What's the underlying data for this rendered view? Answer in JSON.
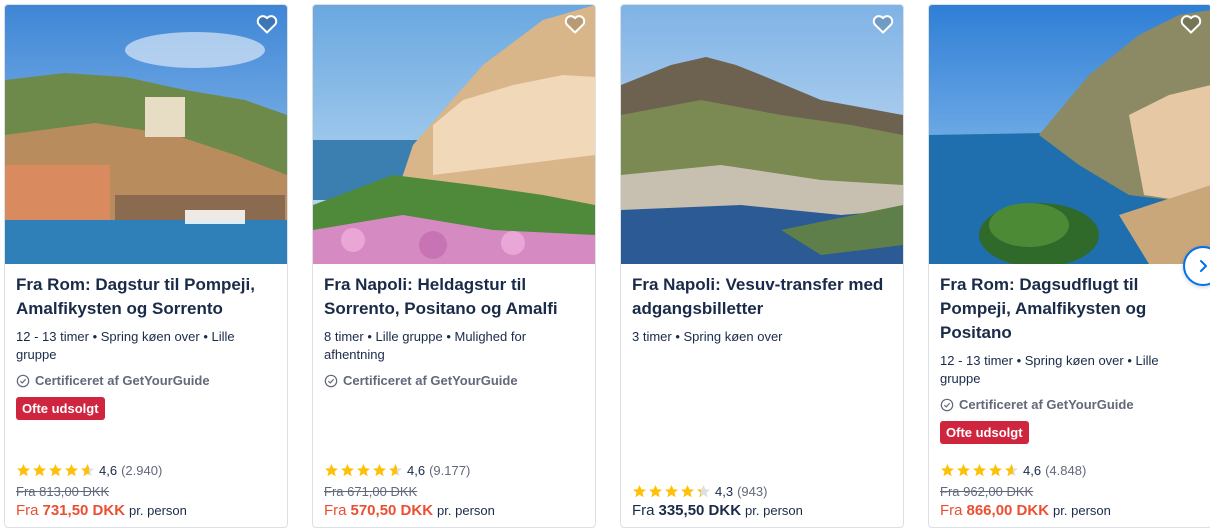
{
  "cards": [
    {
      "title": "Fra Rom: Dagstur til Pompeji, Amalfikysten og Sorrento",
      "meta": "12 - 13 timer • Spring køen over • Lille gruppe",
      "certified": "Certificeret af GetYourGuide",
      "badge": "Ofte udsolgt",
      "rating": "4,6",
      "rating_value": 4.6,
      "reviews": "(2.940)",
      "old_price": "Fra 813,00 DKK",
      "price_from": "Fra",
      "price": "731,50 DKK",
      "per": "pr. person",
      "on_sale": true
    },
    {
      "title": "Fra Napoli: Heldagstur til Sorrento, Positano og Amalfi",
      "meta": "8 timer • Lille gruppe • Mulighed for afhentning",
      "certified": "Certificeret af GetYourGuide",
      "badge": "",
      "rating": "4,6",
      "rating_value": 4.6,
      "reviews": "(9.177)",
      "old_price": "Fra 671,00 DKK",
      "price_from": "Fra",
      "price": "570,50 DKK",
      "per": "pr. person",
      "on_sale": true
    },
    {
      "title": "Fra Napoli: Vesuv-transfer med adgangsbilletter",
      "meta": "3 timer • Spring køen over",
      "certified": "",
      "badge": "",
      "rating": "4,3",
      "rating_value": 4.3,
      "reviews": "(943)",
      "old_price": "",
      "price_from": "Fra",
      "price": "335,50 DKK",
      "per": "pr. person",
      "on_sale": false
    },
    {
      "title": "Fra Rom: Dagsudflugt til Pompeji, Amalfikysten og Positano",
      "meta": "12 - 13 timer • Spring køen over • Lille gruppe",
      "certified": "Certificeret af GetYourGuide",
      "badge": "Ofte udsolgt",
      "rating": "4,6",
      "rating_value": 4.6,
      "reviews": "(4.848)",
      "old_price": "Fra 962,00 DKK",
      "price_from": "Fra",
      "price": "866,00 DKK",
      "per": "pr. person",
      "on_sale": true
    }
  ],
  "icons": {
    "favorite": "heart-outline-icon",
    "certified": "check-circle-icon",
    "star": "star-icon",
    "next": "chevron-right-icon"
  },
  "colors": {
    "title": "#1a2b49",
    "sale_price": "#eb4f32",
    "badge": "#d0253f",
    "star": "#ffc107",
    "accent": "#0071eb"
  }
}
